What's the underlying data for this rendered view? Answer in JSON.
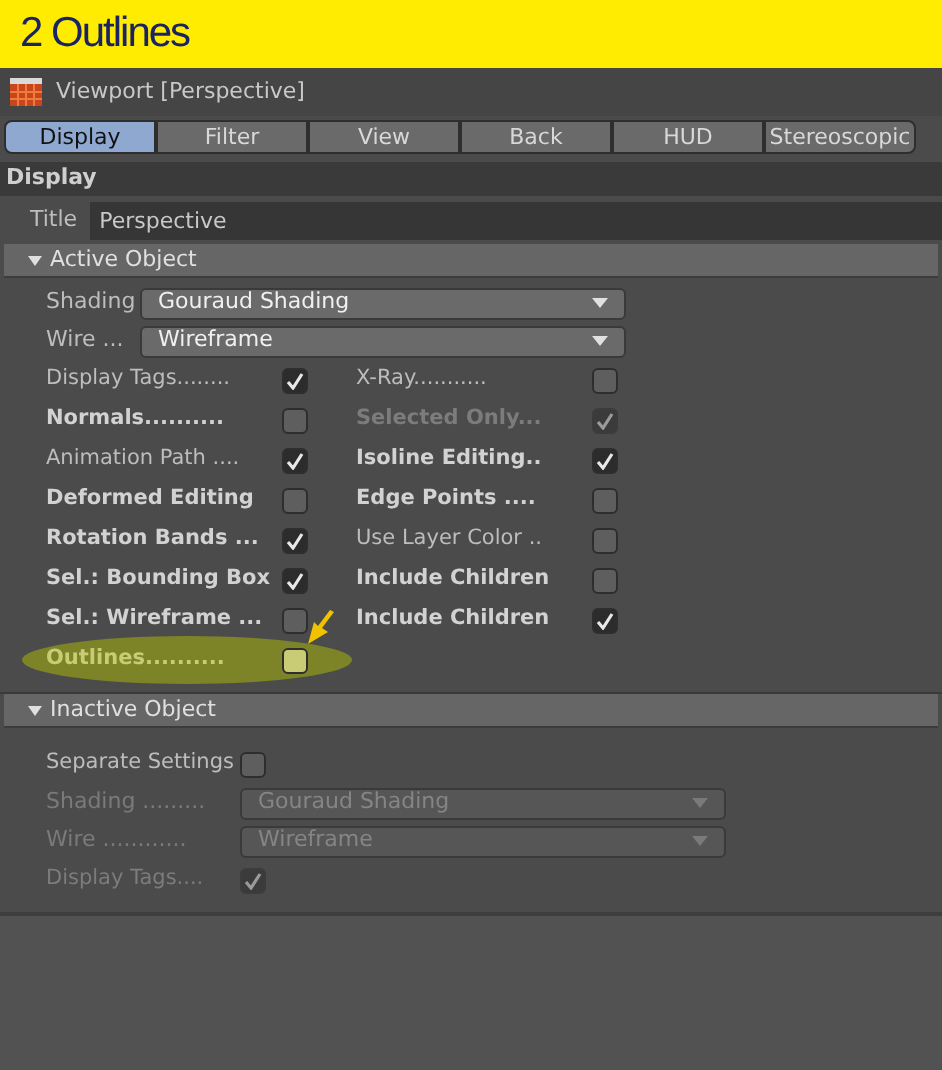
{
  "banner": {
    "title": "2 Outlines"
  },
  "window": {
    "title": "Viewport [Perspective]"
  },
  "tabs": [
    {
      "label": "Display",
      "selected": true
    },
    {
      "label": "Filter",
      "selected": false
    },
    {
      "label": "View",
      "selected": false
    },
    {
      "label": "Back",
      "selected": false
    },
    {
      "label": "HUD",
      "selected": false
    },
    {
      "label": "Stereoscopic",
      "selected": false
    }
  ],
  "section": {
    "title": "Display"
  },
  "title_field": {
    "label": "Title",
    "value": "Perspective"
  },
  "groups": [
    {
      "title": "Active Object",
      "expanded": true,
      "kind": "two_column",
      "rows": [
        {
          "kind": "dropdown",
          "label": "Shading",
          "value": "Gouraud Shading",
          "disabled": false
        },
        {
          "kind": "dropdown",
          "label": "Wire ...",
          "value": "Wireframe",
          "disabled": false
        },
        {
          "kind": "checks",
          "items": [
            {
              "label": "Display Tags........",
              "checked": true,
              "bold": false,
              "disabled": false,
              "highlighted": false
            },
            {
              "label": "X-Ray...........",
              "checked": false,
              "bold": false,
              "disabled": false,
              "highlighted": false
            }
          ]
        },
        {
          "kind": "checks",
          "items": [
            {
              "label": "Normals..........",
              "checked": false,
              "bold": true,
              "disabled": false,
              "highlighted": false
            },
            {
              "label": "Selected Only...",
              "checked": true,
              "bold": true,
              "disabled": true,
              "highlighted": false
            }
          ]
        },
        {
          "kind": "checks",
          "items": [
            {
              "label": "Animation Path ....",
              "checked": true,
              "bold": false,
              "disabled": false,
              "highlighted": false
            },
            {
              "label": "Isoline Editing..",
              "checked": true,
              "bold": true,
              "disabled": false,
              "highlighted": false
            }
          ]
        },
        {
          "kind": "checks",
          "items": [
            {
              "label": "Deformed Editing",
              "checked": false,
              "bold": true,
              "disabled": false,
              "highlighted": false
            },
            {
              "label": "Edge Points ....",
              "checked": false,
              "bold": true,
              "disabled": false,
              "highlighted": false
            }
          ]
        },
        {
          "kind": "checks",
          "items": [
            {
              "label": "Rotation Bands ...",
              "checked": true,
              "bold": true,
              "disabled": false,
              "highlighted": false
            },
            {
              "label": "Use Layer Color ..",
              "checked": false,
              "bold": false,
              "disabled": false,
              "highlighted": false
            }
          ]
        },
        {
          "kind": "checks",
          "items": [
            {
              "label": "Sel.: Bounding Box",
              "checked": true,
              "bold": true,
              "disabled": false,
              "highlighted": false
            },
            {
              "label": "Include Children",
              "checked": false,
              "bold": true,
              "disabled": false,
              "highlighted": false
            }
          ]
        },
        {
          "kind": "checks",
          "items": [
            {
              "label": "Sel.: Wireframe ...",
              "checked": false,
              "bold": true,
              "disabled": false,
              "highlighted": false
            },
            {
              "label": "Include Children",
              "checked": true,
              "bold": true,
              "disabled": false,
              "highlighted": false
            }
          ]
        },
        {
          "kind": "checks",
          "items": [
            {
              "label": "Outlines..........",
              "checked": false,
              "bold": true,
              "disabled": false,
              "highlighted": true
            }
          ]
        }
      ]
    },
    {
      "title": "Inactive Object",
      "expanded": true,
      "kind": "single_column",
      "rows": [
        {
          "kind": "checks",
          "items": [
            {
              "label": "Separate Settings",
              "checked": false,
              "bold": false,
              "disabled": false,
              "highlighted": false
            }
          ]
        },
        {
          "kind": "dropdown",
          "label": "Shading .........",
          "value": "Gouraud Shading",
          "disabled": true
        },
        {
          "kind": "dropdown",
          "label": "Wire ............",
          "value": "Wireframe",
          "disabled": true
        },
        {
          "kind": "checks",
          "items": [
            {
              "label": "Display Tags....",
              "checked": true,
              "bold": false,
              "disabled": true,
              "highlighted": false
            }
          ]
        }
      ]
    }
  ]
}
